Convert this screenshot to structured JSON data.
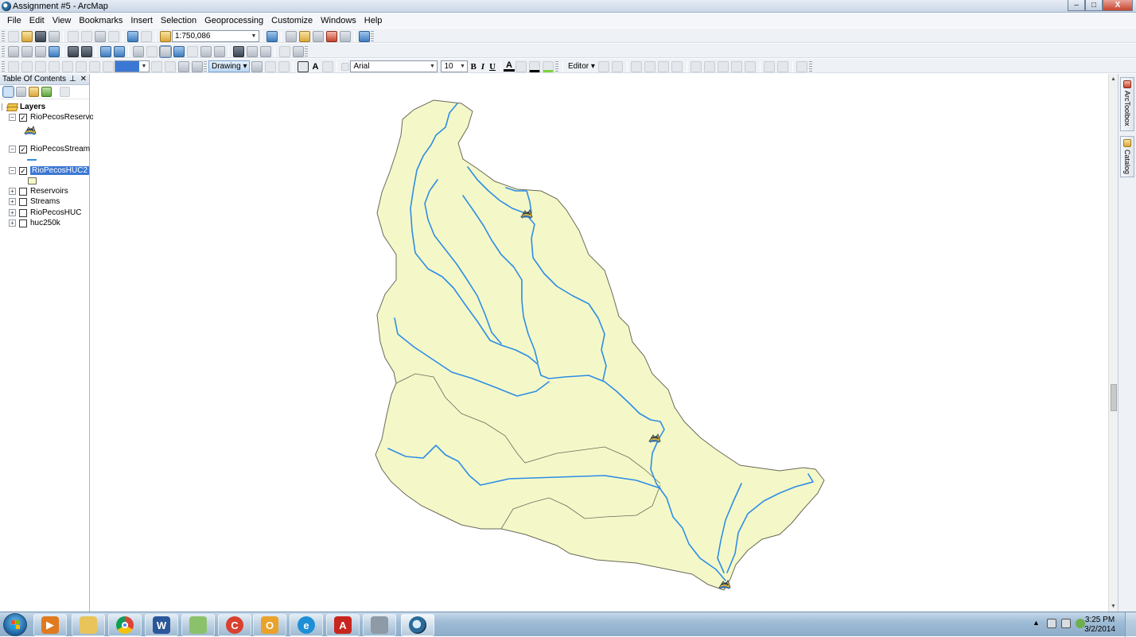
{
  "window": {
    "title": "Assignment #5 - ArcMap",
    "buttons": [
      "–",
      "□",
      "X"
    ]
  },
  "menu": [
    "File",
    "Edit",
    "View",
    "Bookmarks",
    "Insert",
    "Selection",
    "Geoprocessing",
    "Customize",
    "Windows",
    "Help"
  ],
  "standard_toolbar": {
    "scale": "1:750,086"
  },
  "draw_toolbar": {
    "drawing_label": "Drawing ▾",
    "font": "Arial",
    "font_size": "10",
    "bold": "B",
    "italic": "I",
    "underline": "U",
    "text_color_glyph": "A",
    "editor_label": "Editor ▾"
  },
  "toc": {
    "title": "Table Of Contents",
    "pin": "✕",
    "layers_root": "Layers",
    "items": [
      {
        "name": "RioPecosReservoir",
        "checked": true,
        "expanded": true,
        "symbol": "reservoir-symbol"
      },
      {
        "name": "RioPecosStream",
        "checked": true,
        "expanded": true,
        "symbol": "line-symbol",
        "color": "#2e8de6"
      },
      {
        "name": "RioPecosHUC2",
        "checked": true,
        "expanded": true,
        "selected": true,
        "symbol": "polygon-symbol",
        "color": "#f4f8c8"
      },
      {
        "name": "Reservoirs",
        "checked": false,
        "expanded": false
      },
      {
        "name": "Streams",
        "checked": false,
        "expanded": false
      },
      {
        "name": "RioPecosHUC",
        "checked": false,
        "expanded": false
      },
      {
        "name": "huc250k",
        "checked": false,
        "expanded": false
      }
    ]
  },
  "dock_tabs": [
    "ArcToolbox",
    "Catalog"
  ],
  "taskbar": {
    "clock_time": "3:25 PM",
    "clock_date": "3/2/2014"
  },
  "map_colors": {
    "watershed_fill": "#f4f8c8",
    "boundary": "#6a6a5a",
    "stream": "#2e8de6"
  }
}
